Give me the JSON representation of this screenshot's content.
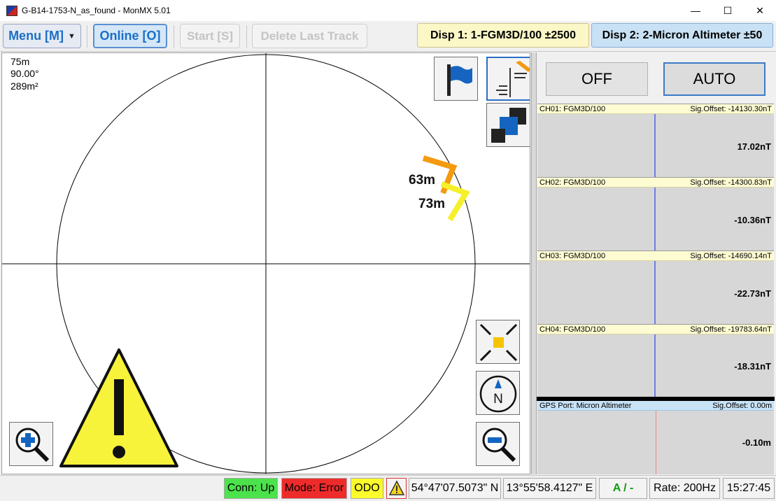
{
  "window": {
    "title": "G-B14-1753-N_as_found - MonMX 5.01",
    "minimize": "—",
    "maximize": "☐",
    "close": "✕"
  },
  "toolbar": {
    "menu_label": "Menu [M]",
    "online_label": "Online [O]",
    "start_label": "Start [S]",
    "delete_label": "Delete Last Track",
    "disp1_label": "Disp 1: 1-FGM3D/100  ±2500",
    "disp2_label": "Disp 2: 2-Micron Altimeter  ±50"
  },
  "map": {
    "scale": "75m",
    "heading": "90.00°",
    "area": "289m²",
    "track_labels": [
      {
        "text": "63m",
        "color": "#f39a0f"
      },
      {
        "text": "73m",
        "color": "#f5e61a"
      }
    ],
    "icons": {
      "flag": "flag-icon",
      "layers": "layers-icon",
      "panels": "panels-icon",
      "center": "center-icon",
      "compass": "compass-icon",
      "zoom_in": "zoom-in-icon",
      "zoom_out": "zoom-out-icon",
      "warning": "warning-icon"
    },
    "compass_letter": "N",
    "warning_color": "#f7f33a"
  },
  "panel": {
    "off_label": "OFF",
    "auto_label": "AUTO",
    "channels": [
      {
        "name": "CH01: FGM3D/100",
        "offset": "Sig.Offset: -14130.30nT",
        "value": "17.02nT"
      },
      {
        "name": "CH02: FGM3D/100",
        "offset": "Sig.Offset: -14300.83nT",
        "value": "-10.36nT"
      },
      {
        "name": "CH03: FGM3D/100",
        "offset": "Sig.Offset: -14690.14nT",
        "value": "-22.73nT"
      },
      {
        "name": "CH04: FGM3D/100",
        "offset": "Sig.Offset: -19783.64nT",
        "value": "-18.31nT"
      }
    ],
    "gps": {
      "name": "GPS Port: Micron Altimeter",
      "offset": "Sig.Offset: 0.00m",
      "value": "-0.10m"
    }
  },
  "status": {
    "conn": "Conn: Up",
    "mode": "Mode: Error",
    "odo": "ODO",
    "lat": "54°47'07.5073\" N",
    "lon": "13°55'58.4127\" E",
    "ak": "A / -",
    "rate": "Rate: 200Hz",
    "time": "15:27:45",
    "colors": {
      "conn": "#4ce24c",
      "mode": "#ee2b2b",
      "odo": "#fcfc2a"
    }
  }
}
